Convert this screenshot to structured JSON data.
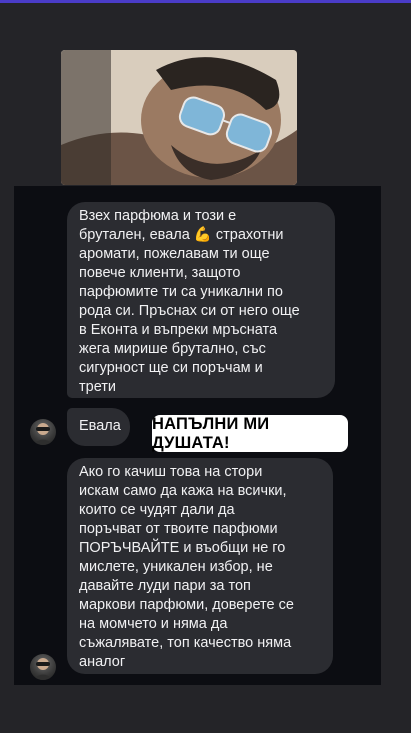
{
  "story": {
    "accent_color": "#4a3cc8",
    "photo": {
      "icon": "selfie-photo"
    }
  },
  "chat": {
    "messages": [
      {
        "text": "Взех парфюма и този е\nбрутален, евала 💪 страхотни\nаромати, пожелавам ти още\nповече клиенти, защото\nпарфюмите ти са уникални по\nрода си. Пръснах си от него още\nв Еконта и въпреки мръсната\nжега мирише брутално, със\nсигурност ще си поръчам и\nтрети"
      },
      {
        "text": "Евала"
      },
      {
        "text": "Ако го качиш това на стори\nискам само да кажа на всички,\nкоито се чудят дали да\nпоръчват от твоите парфюми\nПОРЪЧВАЙТЕ и въобщи не го\nмислете, уникален избор, не\nдавайте луди пари за топ\nмаркови парфюми, доверете се\nна момчето и няма да\nсъжалявате, топ качество няма\nаналог"
      }
    ]
  },
  "sticker": {
    "text": "НАПЪЛНИ МИ ДУШАТА!"
  }
}
